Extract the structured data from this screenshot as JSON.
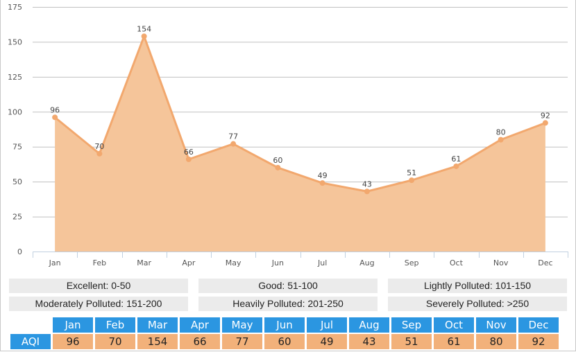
{
  "chart_data": {
    "type": "area",
    "title": "",
    "xlabel": "",
    "ylabel": "",
    "categories": [
      "Jan",
      "Feb",
      "Mar",
      "Apr",
      "May",
      "Jun",
      "Jul",
      "Aug",
      "Sep",
      "Oct",
      "Nov",
      "Dec"
    ],
    "series": [
      {
        "name": "AQI",
        "values": [
          96,
          70,
          154,
          66,
          77,
          60,
          49,
          43,
          51,
          61,
          80,
          92
        ]
      }
    ],
    "ylim": [
      0,
      175
    ],
    "yticks": [
      0,
      25,
      50,
      75,
      100,
      125,
      150,
      175
    ],
    "ytick_labels": [
      "0",
      "25",
      "50",
      "75",
      "100",
      "125",
      "150",
      "175"
    ],
    "grid": true,
    "data_labels": true,
    "colors": {
      "fill": "#f5c59a",
      "line": "#f2a86e",
      "grid": "#c0c0c0",
      "axis": "#c0d0e0"
    }
  },
  "legend": [
    {
      "label": "Excellent: 0-50"
    },
    {
      "label": "Good: 51-100"
    },
    {
      "label": "Lightly Polluted: 101-150"
    },
    {
      "label": "Moderately Polluted: 151-200"
    },
    {
      "label": "Heavily Polluted: 201-250"
    },
    {
      "label": "Severely Polluted: >250"
    }
  ],
  "table": {
    "row_label": "AQI",
    "months": [
      "Jan",
      "Feb",
      "Mar",
      "Apr",
      "May",
      "Jun",
      "Jul",
      "Aug",
      "Sep",
      "Oct",
      "Nov",
      "Dec"
    ],
    "values": [
      "96",
      "70",
      "154",
      "66",
      "77",
      "60",
      "49",
      "43",
      "51",
      "61",
      "80",
      "92"
    ],
    "colors": {
      "header_bg": "#2b96e1",
      "value_bg": "#f2b17a"
    }
  }
}
